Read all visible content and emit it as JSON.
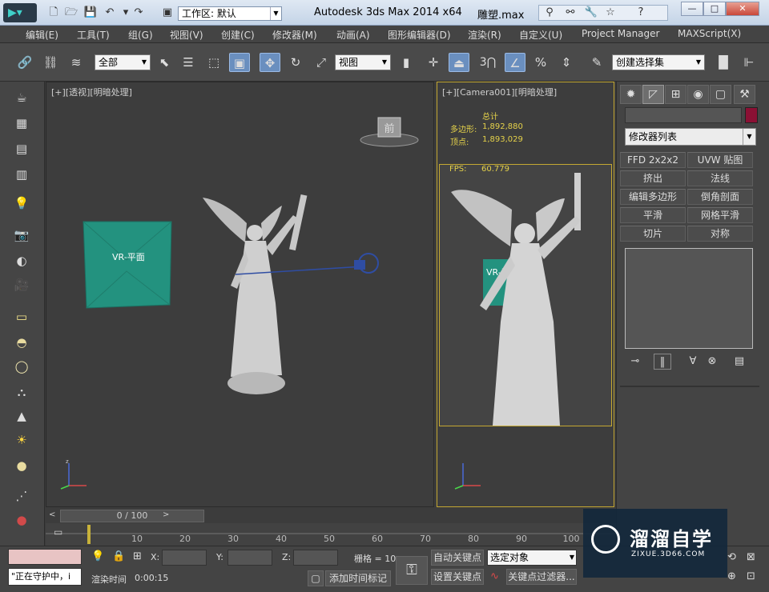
{
  "window": {
    "app_title": "Autodesk 3ds Max  2014 x64",
    "file_title": "雕塑.max",
    "workspace_label": "工作区: 默认",
    "minimize": "—",
    "maximize": "□",
    "close": "✕"
  },
  "menu": [
    "编辑(E)",
    "工具(T)",
    "组(G)",
    "视图(V)",
    "创建(C)",
    "修改器(M)",
    "动画(A)",
    "图形编辑器(D)",
    "渲染(R)",
    "自定义(U)",
    "Project Manager",
    "MAXScript(X)"
  ],
  "toolbar": {
    "selection_filter": "全部",
    "ref_coord": "视图",
    "snap_number": "3",
    "named_selection": "创建选择集"
  },
  "viewports": {
    "perspective_label": "[+][透视][明暗处理]",
    "perspective_plane_label": "VR-平面",
    "viewcube_label": "前",
    "camera_label": "[+][Camera001][明暗处理]",
    "camera_plane_label": "VR-平面",
    "stats": {
      "header": "总计",
      "poly_label": "多边形:",
      "poly_value": "1,892,880",
      "vert_label": "顶点:",
      "vert_value": "1,893,029",
      "fps_label": "FPS:",
      "fps_value": "60.779"
    }
  },
  "command_panel": {
    "modifier_list": "修改器列表",
    "buttons": [
      "FFD 2x2x2",
      "UVW 贴图",
      "挤出",
      "法线",
      "编辑多边形",
      "倒角剖面",
      "平滑",
      "网格平滑",
      "切片",
      "对称"
    ],
    "object_color": "#8b1034"
  },
  "timeline": {
    "frame_display": "0 / 100",
    "ticks": [
      "10",
      "20",
      "30",
      "40",
      "50",
      "60",
      "70",
      "80",
      "90",
      "100"
    ]
  },
  "status": {
    "prompt": "\"正在守护中，i",
    "x_label": "X:",
    "y_label": "Y:",
    "z_label": "Z:",
    "grid": "栅格 = 10",
    "render_time_label": "渲染时间",
    "render_time_value": "0:00:15",
    "add_time_tag": "添加时间标记",
    "auto_key": "自动关键点",
    "set_key": "设置关键点",
    "selected_object": "选定对象",
    "key_filters": "关键点过滤器..."
  },
  "watermark": {
    "text": "溜溜自学",
    "sub": "ZIXUE.3D66.COM"
  }
}
